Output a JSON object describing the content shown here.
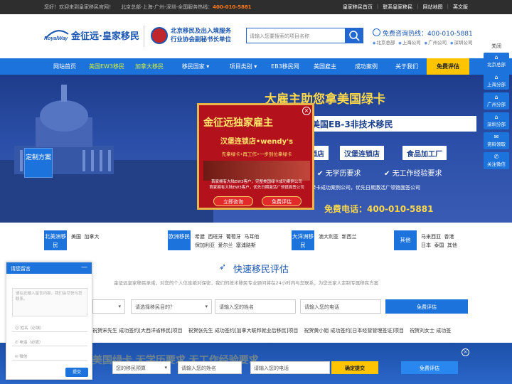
{
  "topbar": {
    "welcome": "您好！欢迎来到皇家移民官网！",
    "offices": "北京总部-上海-广州-深圳-全国服务热线：",
    "phone": "400-010-5881",
    "links": [
      "皇家移民首页",
      "联系皇家移民",
      "网站地图",
      "英文版"
    ]
  },
  "header": {
    "logo_en": "RoyalWay",
    "logo_cn": "金征远·皇家移民",
    "assoc_line1": "北京移民及出入境服务",
    "assoc_line2": "行业协会副秘书长单位",
    "search_placeholder": "请输入您要搜索的项目名称",
    "hotline": "免费咨询热线：400-010-5881",
    "offices": [
      "北京总部",
      "上海公司",
      "广州公司",
      "深圳公司"
    ]
  },
  "nav": {
    "items": [
      {
        "label": "网站首页",
        "style": "normal"
      },
      {
        "label": "美国EW3移民",
        "style": "green"
      },
      {
        "label": "加拿大移民",
        "style": "green"
      },
      {
        "label": "移民国家 ▾",
        "style": "normal"
      },
      {
        "label": "项目类别 ▾",
        "style": "normal"
      },
      {
        "label": "EB3移民网",
        "style": "normal"
      },
      {
        "label": "美国雇主",
        "style": "normal"
      },
      {
        "label": "成功案例",
        "style": "normal"
      },
      {
        "label": "关于我们",
        "style": "normal"
      },
      {
        "label": "免费评估",
        "style": "cta"
      }
    ]
  },
  "banner": {
    "headline": "大雇主助您拿美国绿卡",
    "subhead": "美国EB-3非技术移民",
    "tags": [
      "酒店",
      "汉堡连锁店",
      "食品加工厂"
    ],
    "checks": [
      "无学历要求",
      "无工作经验要求"
    ],
    "small": "国绿卡成功案例公司，优先日期激活广领馆面签公司",
    "phone": "免费电话：400-010-5881",
    "custom_tab": "定制方案"
  },
  "popup": {
    "title": "金征远独家雇主",
    "subtitle": "汉堡连锁店•wendy's",
    "tagline": "先拿绿卡•再工作•一步到位拿绿卡",
    "note1": "首家拥有大陆EW3客户，完整美国绿卡成功案例公司",
    "note2": "首家拥有大陆EW3客户，优先日期激活广领馆面签公司",
    "btn_consult": "立即咨询",
    "btn_eval": "免费评估",
    "close": "×"
  },
  "side": {
    "close": "关闭",
    "items": [
      {
        "label": "北京总部",
        "icon": "⌂"
      },
      {
        "label": "上海分部",
        "icon": "⌂"
      },
      {
        "label": "广州分部",
        "icon": "⌂"
      },
      {
        "label": "深圳分部",
        "icon": "⌂"
      },
      {
        "label": "资料领取",
        "icon": "✉"
      },
      {
        "label": "关注微信",
        "icon": "✆"
      }
    ]
  },
  "regions": [
    {
      "label": "北美洲移民",
      "countries": [
        "美国",
        "加拿大"
      ]
    },
    {
      "label": "欧洲移民",
      "countries": [
        "希腊",
        "西班牙",
        "葡萄牙",
        "马耳他",
        "保加利亚",
        "爱尔兰",
        "塞浦路斯"
      ]
    },
    {
      "label": "大洋洲移民",
      "countries": [
        "澳大利亚",
        "新西兰"
      ]
    },
    {
      "label": "其他",
      "countries": [
        "马来西亚",
        "香港",
        "日本",
        "泰国",
        "其他"
      ]
    }
  ],
  "evaluation": {
    "title": "快速移民评估",
    "subtitle": "金征远皇家移民承诺，对您的个人信息绝对保密，我们的技术移民专业顾问将在24小时内与您联系，为您总家人定制专属移民方案",
    "select_country": "",
    "select_purpose": "请选择移民目的？",
    "name_placeholder": "请输入您的姓名",
    "phone_placeholder": "请输入您的电话",
    "submit": "免费评估"
  },
  "ticker": [
    "祝贺宋先生 成功签约[大西洋省移民]项目",
    "祝贺张先生 成功签约[加拿大联邦就业后移民]项目",
    "祝贺黄小姐 成功签约[日本经营管理签证]项目",
    "祝贺刘女士 成功签"
  ],
  "bottom_bar": {
    "bg_text": "美国绿卡 无学历要求 无工作经验要求",
    "budget": "您的移民预算",
    "name": "请输入您的姓名",
    "phone": "请输入您的电话",
    "confirm": "确定提交",
    "eval": "免费评估",
    "close": "×"
  },
  "chat": {
    "title": "请您留言",
    "minimize": "—",
    "message_placeholder": "请在此输入留言内容，我们会尽快与您联系。",
    "name": "姓名（必填）",
    "phone": "电话（必填）",
    "wechat": "微信",
    "submit": "提交"
  }
}
